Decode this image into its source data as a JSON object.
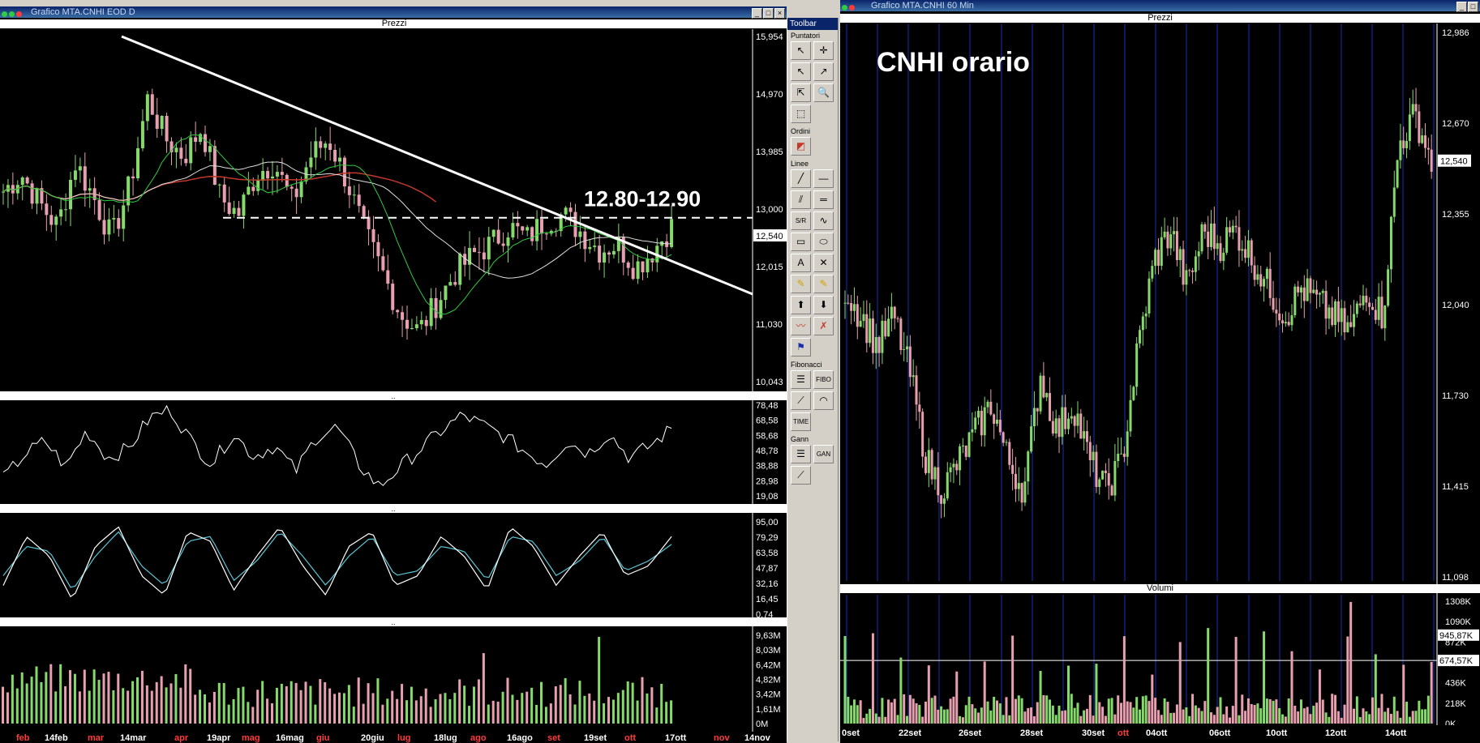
{
  "left_window": {
    "title": "Grafico MTA.CNHI EOD D",
    "price_pane_label": "Prezzi",
    "annotation_resistance": "12.80-12.90",
    "price_ticks": [
      "15,954",
      "14,970",
      "13,985",
      "13,000",
      "12,015",
      "11,030",
      "10,043"
    ],
    "last_price": "12,540",
    "rsi_ticks": [
      "78,48",
      "68,58",
      "58,68",
      "48,78",
      "38,88",
      "28,98",
      "19,08"
    ],
    "stoch_ticks": [
      "95,00",
      "79,29",
      "63,58",
      "47,87",
      "32,16",
      "16,45",
      "0,74"
    ],
    "vol_ticks": [
      "9,63M",
      "8,03M",
      "6,42M",
      "4,82M",
      "3,42M",
      "1,61M",
      "0M"
    ],
    "dates": [
      {
        "label": "feb",
        "color": "#ff3b3b"
      },
      {
        "label": "14feb",
        "color": "#ffffff"
      },
      {
        "label": "mar",
        "color": "#ff3b3b"
      },
      {
        "label": "14mar",
        "color": "#ffffff"
      },
      {
        "label": "apr",
        "color": "#ff3b3b"
      },
      {
        "label": "19apr",
        "color": "#ffffff"
      },
      {
        "label": "mag",
        "color": "#ff3b3b"
      },
      {
        "label": "16mag",
        "color": "#ffffff"
      },
      {
        "label": "giu",
        "color": "#ff3b3b"
      },
      {
        "label": "20giu",
        "color": "#ffffff"
      },
      {
        "label": "lug",
        "color": "#ff3b3b"
      },
      {
        "label": "18lug",
        "color": "#ffffff"
      },
      {
        "label": "ago",
        "color": "#ff3b3b"
      },
      {
        "label": "16ago",
        "color": "#ffffff"
      },
      {
        "label": "set",
        "color": "#ff3b3b"
      },
      {
        "label": "19set",
        "color": "#ffffff"
      },
      {
        "label": "ott",
        "color": "#ff3b3b"
      },
      {
        "label": "17ott",
        "color": "#ffffff"
      },
      {
        "label": "nov",
        "color": "#ff3b3b"
      },
      {
        "label": "14nov",
        "color": "#ffffff"
      }
    ]
  },
  "right_window": {
    "title": "Grafico MTA.CNHI 60 Min",
    "price_pane_label": "Prezzi",
    "volume_pane_label": "Volumi",
    "annotation_title": "CNHI orario",
    "price_ticks": [
      "12,986",
      "12,670",
      "12,355",
      "12,040",
      "11,730",
      "11,415",
      "11,098"
    ],
    "last_price": "12,540",
    "vol_ticks": [
      "1308K",
      "1090K",
      "872K",
      "436K",
      "218K",
      "0K"
    ],
    "vol_markers": [
      "945,87K",
      "674,57K"
    ],
    "dates": [
      {
        "label": "0set",
        "color": "#ffffff"
      },
      {
        "label": "22set",
        "color": "#ffffff"
      },
      {
        "label": "26set",
        "color": "#ffffff"
      },
      {
        "label": "28set",
        "color": "#ffffff"
      },
      {
        "label": "30set",
        "color": "#ffffff"
      },
      {
        "label": "ott",
        "color": "#ff3b3b"
      },
      {
        "label": "04ott",
        "color": "#ffffff"
      },
      {
        "label": "06ott",
        "color": "#ffffff"
      },
      {
        "label": "10ott",
        "color": "#ffffff"
      },
      {
        "label": "12ott",
        "color": "#ffffff"
      },
      {
        "label": "14ott",
        "color": "#ffffff"
      }
    ]
  },
  "toolbar": {
    "title": "Toolbar",
    "sections": [
      "Puntatori",
      "Ordini",
      "Linee",
      "Fibonacci",
      "Gann"
    ]
  },
  "colors": {
    "up": "#86d96b",
    "down": "#e8a0b0",
    "ma_long": "#c0392b",
    "ma_mid": "#e0e0e0",
    "ma_short": "#2ecc40",
    "stoch_k": "#ffffff",
    "stoch_d": "#5bc8d8",
    "grid_v": "#1a2fb0"
  },
  "chart_data": [
    {
      "type": "line",
      "title": "Grafico MTA.CNHI EOD D",
      "note_text": "12.80-12.90",
      "x_range": [
        "feb",
        "14nov"
      ],
      "ylim": [
        10.043,
        15.954
      ],
      "series": [
        {
          "values": [
            13.3,
            13.6,
            13.1,
            12.7,
            13.8,
            13.2,
            12.5,
            13.4,
            14.9,
            14.2,
            13.9,
            14.4,
            13.2,
            12.9,
            13.6,
            13.8,
            13.1,
            13.9,
            14.2,
            13.5,
            12.6,
            11.9,
            11.2,
            10.9,
            11.4,
            11.9,
            12.2,
            12.4,
            12.7,
            12.5,
            12.8,
            12.9,
            12.6,
            12.3,
            12.4,
            12.0,
            12.3,
            12.7
          ]
        }
      ],
      "levels": {
        "resistance_dashed": 12.85,
        "last_price": 12.54
      }
    },
    {
      "type": "line",
      "title": "",
      "ylim": [
        19.08,
        78.48
      ],
      "series": [
        {
          "values": [
            30,
            46,
            55,
            38,
            62,
            44,
            50,
            70,
            76,
            55,
            40,
            60,
            45,
            52,
            35,
            58,
            64,
            40,
            25,
            38,
            50,
            62,
            72,
            65,
            58,
            48,
            40,
            55,
            47,
            60,
            44,
            52,
            63
          ]
        }
      ]
    },
    {
      "type": "line",
      "title": "",
      "ylim": [
        0.74,
        95.0
      ],
      "series": [
        {
          "values": [
            30,
            80,
            60,
            15,
            70,
            90,
            40,
            20,
            85,
            75,
            25,
            60,
            90,
            50,
            20,
            70,
            85,
            30,
            40,
            80,
            60,
            25,
            90,
            70,
            30,
            60,
            85,
            40,
            50,
            80
          ]
        },
        {
          "values": [
            40,
            70,
            65,
            25,
            60,
            85,
            50,
            30,
            75,
            80,
            35,
            55,
            85,
            60,
            30,
            60,
            80,
            40,
            45,
            70,
            65,
            35,
            80,
            75,
            40,
            55,
            80,
            45,
            55,
            72
          ]
        }
      ]
    },
    {
      "type": "bar",
      "title": "",
      "ylim": [
        0,
        9.63
      ]
    },
    {
      "type": "line",
      "title": "CNHI orario",
      "ylim": [
        11.098,
        12.986
      ],
      "series": [
        {
          "values": [
            12.1,
            12.0,
            11.9,
            12.0,
            11.8,
            11.5,
            11.4,
            11.5,
            11.6,
            11.7,
            11.5,
            11.4,
            11.8,
            11.6,
            11.7,
            11.5,
            11.4,
            11.5,
            11.9,
            12.2,
            12.3,
            12.1,
            12.3,
            12.25,
            12.3,
            12.2,
            12.1,
            12.0,
            12.1,
            12.05,
            12.0,
            11.95,
            12.1,
            12.0,
            12.6,
            12.7,
            12.54
          ]
        }
      ],
      "levels": {
        "last_price": 12.54
      }
    },
    {
      "type": "bar",
      "title": "Volumi",
      "ylim": [
        0,
        1308
      ],
      "levels": {
        "marker_1": 945.87,
        "marker_2": 674.57
      }
    }
  ]
}
